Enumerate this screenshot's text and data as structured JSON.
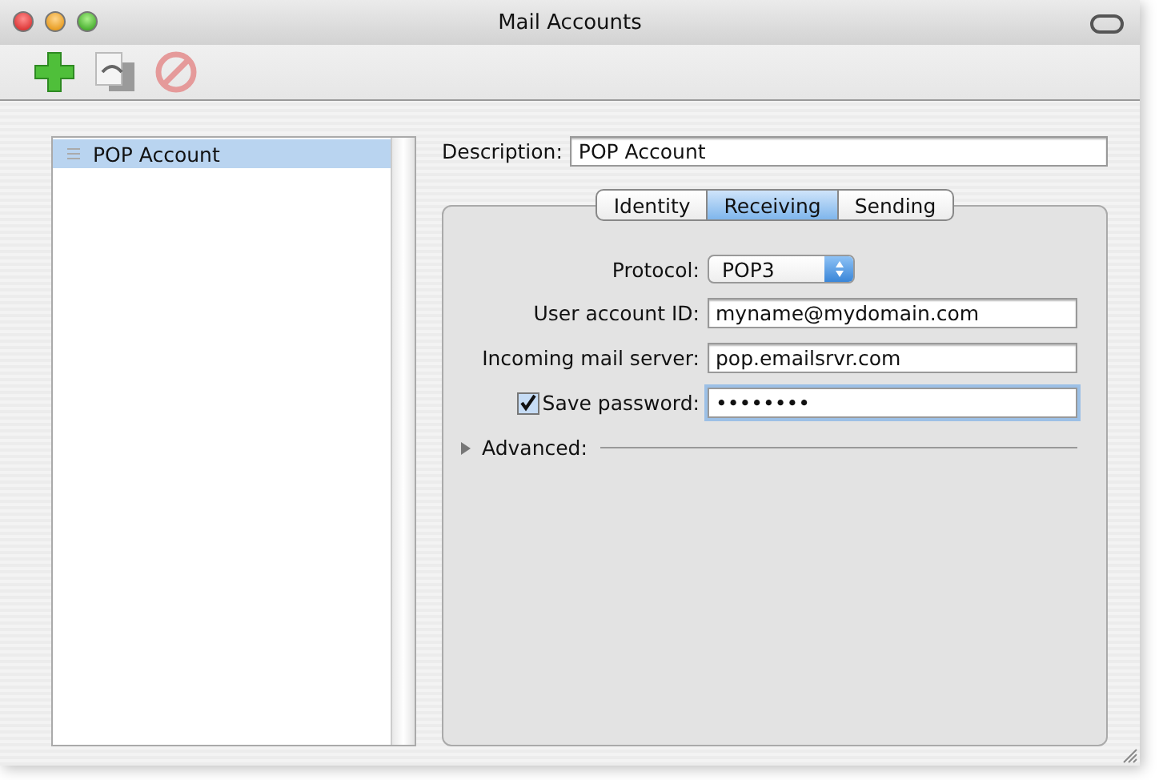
{
  "window": {
    "title": "Mail Accounts"
  },
  "accounts": [
    {
      "label": "POP Account",
      "selected": true
    }
  ],
  "description": {
    "label": "Description:",
    "value": "POP Account"
  },
  "tabs": [
    {
      "label": "Identity",
      "selected": false
    },
    {
      "label": "Receiving",
      "selected": true
    },
    {
      "label": "Sending",
      "selected": false
    }
  ],
  "fields": [
    {
      "kind": "popup",
      "label": "Protocol:",
      "value": "POP3"
    },
    {
      "kind": "text",
      "label": "User account ID:",
      "value": "myname@mydomain.com"
    },
    {
      "kind": "text",
      "label": "Incoming mail server:",
      "value": "pop.emailsrvr.com"
    },
    {
      "kind": "checktext",
      "label": "Save password:",
      "checked": true,
      "value": "••••••••",
      "focused": true
    }
  ],
  "advanced": {
    "label": "Advanced:",
    "expanded": false
  }
}
